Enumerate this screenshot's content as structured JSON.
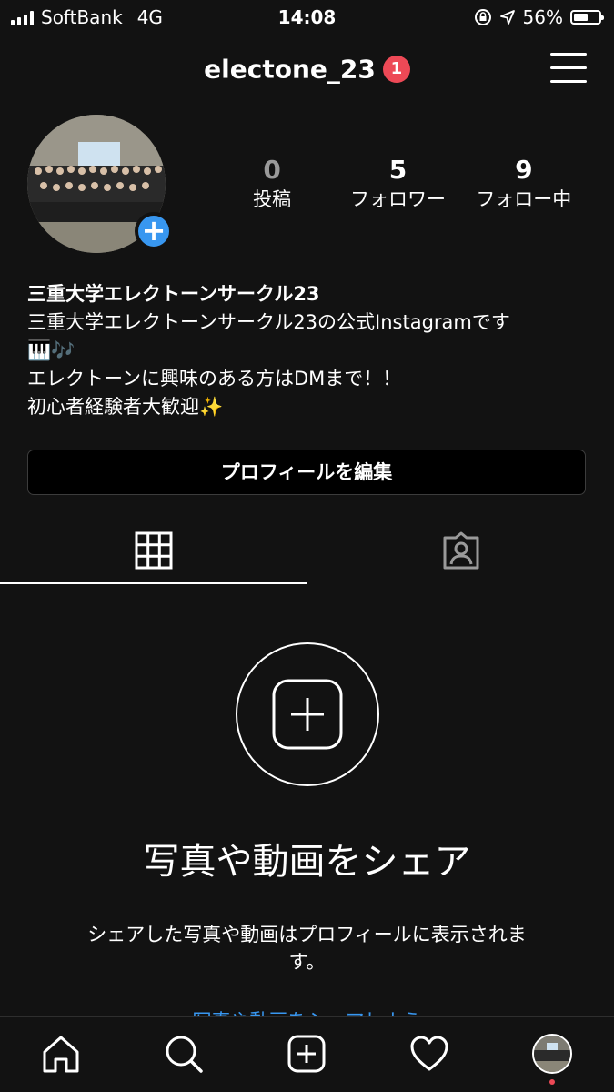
{
  "status_bar": {
    "carrier": "SoftBank",
    "network": "4G",
    "time": "14:08",
    "battery": "56%",
    "battery_level": 0.56
  },
  "header": {
    "username": "electone_23",
    "notification_count": "1"
  },
  "stats": [
    {
      "value": "0",
      "label": "投稿"
    },
    {
      "value": "5",
      "label": "フォロワー"
    },
    {
      "value": "9",
      "label": "フォロー中"
    }
  ],
  "bio": {
    "name": "三重大学エレクトーンサークル23",
    "line1": "三重大学エレクトーンサークル23の公式Instagramです",
    "line2": "🎹🎶",
    "line3": "エレクトーンに興味のある方はDMまで！！",
    "line4": "初心者経験者大歓迎✨"
  },
  "edit_profile_label": "プロフィールを編集",
  "tabs": [
    {
      "icon": "grid-icon",
      "active": true
    },
    {
      "icon": "tagged-person-icon",
      "active": false
    }
  ],
  "empty_state": {
    "icon": "plus-square-icon",
    "title": "写真や動画をシェア",
    "description": "シェアした写真や動画はプロフィールに表示されます。",
    "link": "写真や動画をシェアしよう"
  },
  "bottom_nav": [
    {
      "icon": "home-icon"
    },
    {
      "icon": "search-icon"
    },
    {
      "icon": "new-post-icon"
    },
    {
      "icon": "heart-icon"
    },
    {
      "icon": "profile-avatar-icon"
    }
  ],
  "colors": {
    "background": "#121212",
    "badge": "#ed4956",
    "accent": "#3897f0"
  }
}
